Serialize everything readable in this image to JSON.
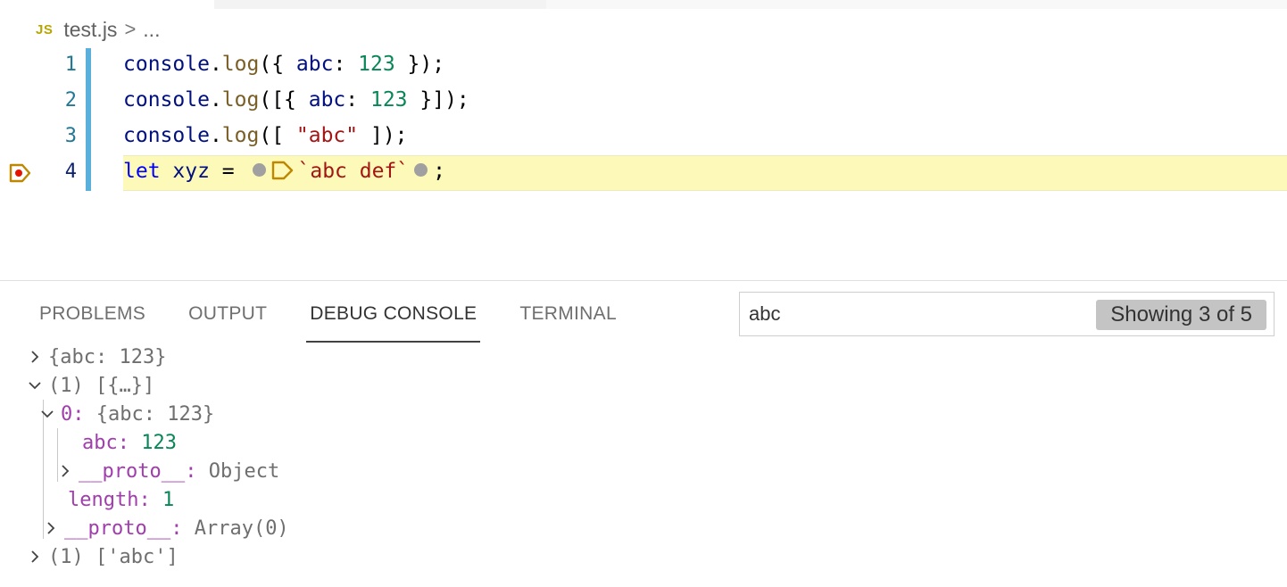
{
  "breadcrumb": {
    "file_icon": "JS",
    "file_name": "test.js",
    "separator": ">",
    "ellipsis": "..."
  },
  "editor": {
    "lines": [
      {
        "number": "1",
        "parts": [
          "console",
          ".",
          "log",
          "({ ",
          "abc",
          ": ",
          "123",
          " });"
        ]
      },
      {
        "number": "2",
        "parts": [
          "console",
          ".",
          "log",
          "([{ ",
          "abc",
          ": ",
          "123",
          " }]);"
        ]
      },
      {
        "number": "3",
        "parts": [
          "console",
          ".",
          "log",
          "([ ",
          "\"abc\"",
          " ]);"
        ]
      },
      {
        "number": "4",
        "parts": [
          "let",
          " ",
          "xyz",
          " = ",
          "`abc def`",
          ";"
        ]
      }
    ],
    "current_line": 4,
    "icons": [
      "breakpoint-stopped-icon",
      "inline-breakpoint-dot-icon",
      "inline-stack-frame-icon"
    ]
  },
  "panel": {
    "tabs": [
      "PROBLEMS",
      "OUTPUT",
      "DEBUG CONSOLE",
      "TERMINAL"
    ],
    "active_tab": "DEBUG CONSOLE",
    "filter": {
      "value": "abc",
      "badge": "Showing 3 of 5"
    }
  },
  "console": {
    "rows": [
      {
        "text": "{abc: 123}"
      },
      {
        "text": "(1) [{…}]"
      },
      {
        "key": "0",
        "sep": ": ",
        "text": "{abc: 123}"
      },
      {
        "key": "abc",
        "sep": ": ",
        "value": "123"
      },
      {
        "key": "__proto__",
        "sep": ": ",
        "text": "Object"
      },
      {
        "key": "length",
        "sep": ": ",
        "value": "1"
      },
      {
        "key": "__proto__",
        "sep": ": ",
        "text": "Array(0)"
      },
      {
        "text": "(1) ['abc']"
      }
    ]
  },
  "colors": {
    "current_line_bg": "#fdf9b8",
    "diff_bar": "#5aafdb",
    "breakpoint": "#e51400",
    "stack_frame": "#be8700",
    "property": "#a13dad",
    "number": "#098658"
  }
}
